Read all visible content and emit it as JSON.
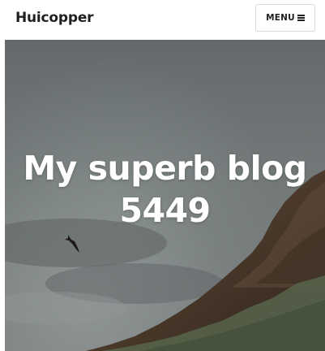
{
  "header": {
    "site_title": "Huicopper",
    "menu_label": "MENU",
    "menu_icon": "hamburger-icon"
  },
  "hero": {
    "title": "My superb blog 5449",
    "background": "foggy cliff with bird"
  },
  "colors": {
    "header_bg": "#ffffff",
    "title_text": "#1f1f1f",
    "hero_text": "#ffffff",
    "fog": "#6c7172",
    "cliff": "#4a3a2c",
    "vegetation": "#56624a"
  }
}
